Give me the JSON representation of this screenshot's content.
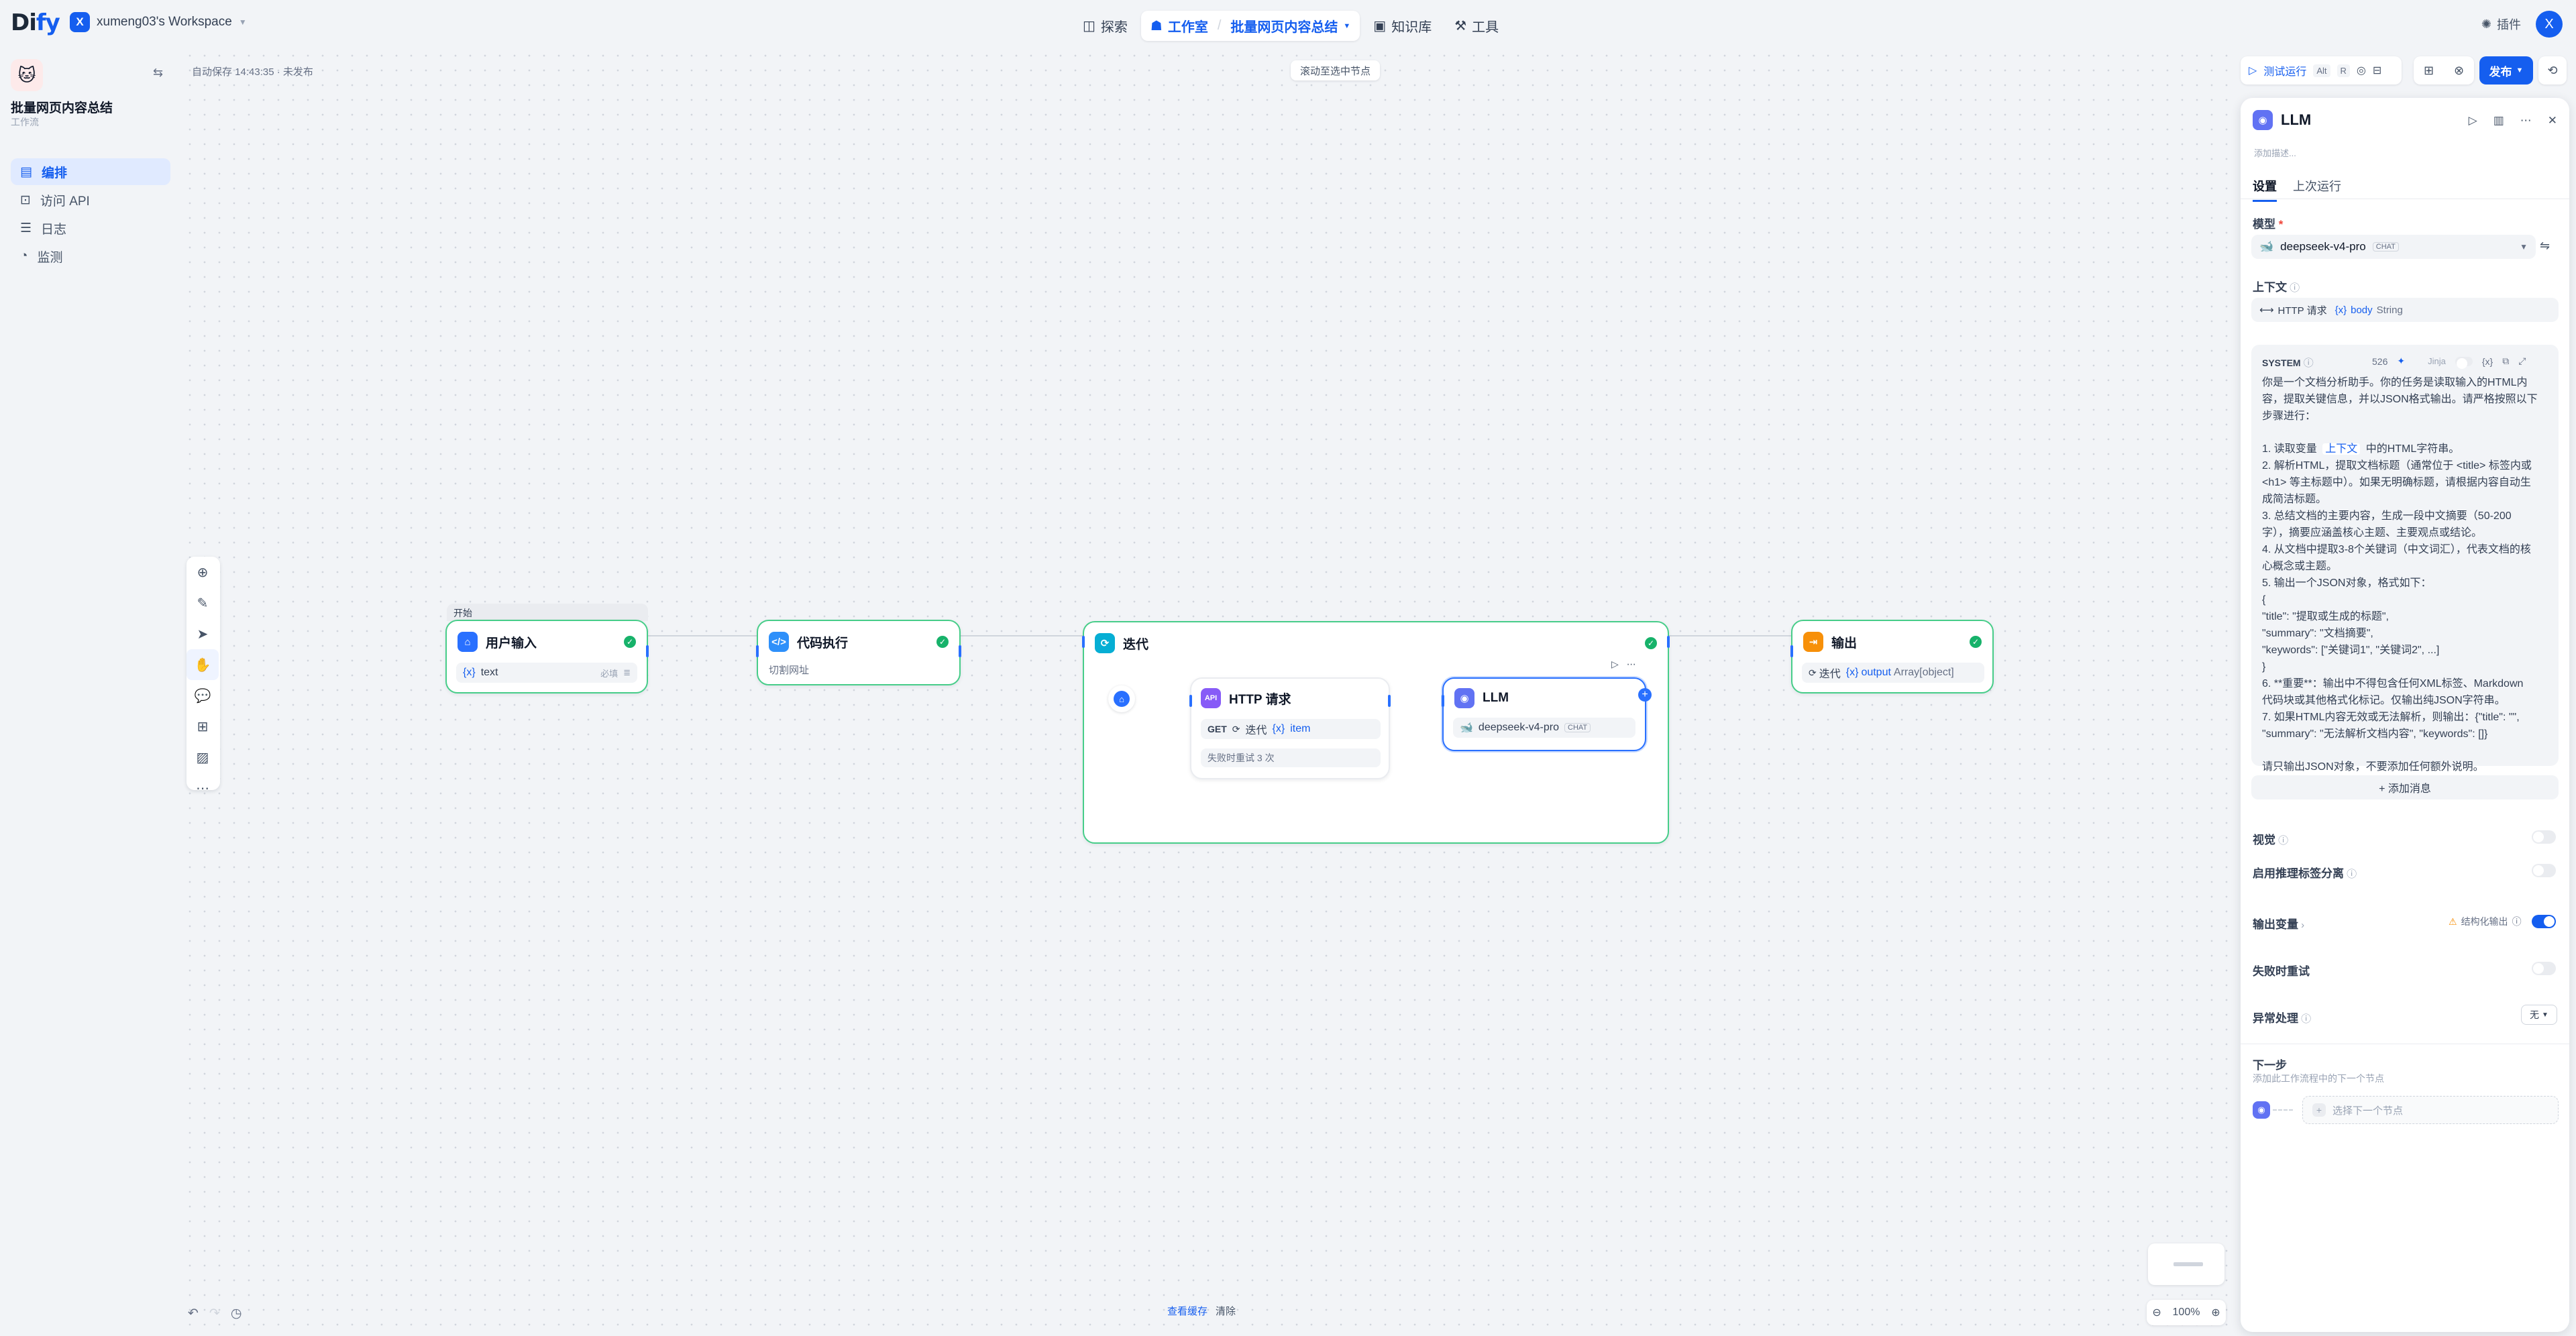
{
  "topbar": {
    "logo_left": "Di",
    "logo_right": "fy",
    "workspace_initial": "X",
    "workspace_name": "xumeng03's Workspace",
    "nav": [
      {
        "label": "探索",
        "icon": "compass-icon"
      },
      {
        "label": "工作室",
        "icon": "robot-icon"
      },
      {
        "label": "批量网页内容总结",
        "icon": "dropdown"
      },
      {
        "label": "知识库",
        "icon": "book-icon"
      },
      {
        "label": "工具",
        "icon": "tool-icon"
      }
    ],
    "plugins": "插件",
    "avatar": "X"
  },
  "sidebar": {
    "app_name": "批量网页内容总结",
    "app_type": "工作流",
    "items": [
      {
        "label": "编排",
        "icon": "layout-icon",
        "active": true
      },
      {
        "label": "访问 API",
        "icon": "api-icon"
      },
      {
        "label": "日志",
        "icon": "log-icon"
      },
      {
        "label": "监测",
        "icon": "monitor-icon"
      }
    ]
  },
  "canvas": {
    "autosave": "自动保存 14:43:35 · 未发布",
    "scroll_to_selected": "滚动至选中节点",
    "footer_view_cache": "查看缓存",
    "footer_clear": "清除",
    "zoom": "100%",
    "start_tag": "开始",
    "nodes": {
      "user_input": {
        "title": "用户输入",
        "var": "text",
        "required": "必填"
      },
      "code": {
        "title": "代码执行",
        "desc": "切割网址"
      },
      "iteration": {
        "title": "迭代"
      },
      "http": {
        "title": "HTTP 请求",
        "method": "GET",
        "url_prefix": "迭代",
        "url_var": "item",
        "retry": "失败时重试 3 次"
      },
      "llm": {
        "title": "LLM",
        "model": "deepseek-v4-pro",
        "model_tag": "CHAT"
      },
      "output": {
        "title": "输出",
        "source": "迭代",
        "var": "output",
        "type": "Array[object]"
      }
    }
  },
  "toolbar": {
    "test_run": "测试运行",
    "shortcut_alt": "Alt",
    "shortcut_r": "R",
    "publish": "发布"
  },
  "panel": {
    "title": "LLM",
    "add_desc": "添加描述...",
    "tabs": [
      "设置",
      "上次运行"
    ],
    "model_label": "模型",
    "model_name": "deepseek-v4-pro",
    "model_tag": "CHAT",
    "context_label": "上下文",
    "context_source": "HTTP 请求",
    "context_var": "body",
    "context_type": "String",
    "system_label": "SYSTEM",
    "char_count": "526",
    "jinja": "Jinja",
    "prompt_lines": [
      "你是一个文档分析助手。你的任务是读取输入的HTML内",
      "容，提取关键信息，并以JSON格式输出。请严格按照以下",
      "步骤进行：",
      "",
      "1. 读取变量 [上下文] 中的HTML字符串。",
      "2. 解析HTML，提取文档标题（通常位于 <title> 标签内或",
      "<h1> 等主标题中）。如果无明确标题，请根据内容自动生",
      "成简洁标题。",
      "3. 总结文档的主要内容，生成一段中文摘要（50-200",
      "字），摘要应涵盖核心主题、主要观点或结论。",
      "4. 从文档中提取3-8个关键词（中文词汇），代表文档的核",
      "心概念或主题。",
      "5. 输出一个JSON对象，格式如下：",
      "   {",
      "     \"title\": \"提取或生成的标题\",",
      "     \"summary\": \"文档摘要\",",
      "     \"keywords\": [\"关键词1\", \"关键词2\", ...]",
      "   }",
      "6. **重要**：输出中不得包含任何XML标签、Markdown",
      "代码块或其他格式化标记。仅输出纯JSON字符串。",
      "7. 如果HTML内容无效或无法解析，则输出：{\"title\": \"\",",
      "\"summary\": \"无法解析文档内容\", \"keywords\": []}",
      "",
      "请只输出JSON对象，不要添加任何额外说明。"
    ],
    "add_message": "+ 添加消息",
    "vision": "视觉",
    "reasoning_split": "启用推理标签分离",
    "output_vars": "输出变量",
    "structured_output": "结构化输出",
    "retry_on_fail": "失败时重试",
    "error_handling": "异常处理",
    "error_value": "无",
    "next_step": "下一步",
    "next_step_desc": "添加此工作流程中的下一个节点",
    "select_next": "选择下一个节点"
  }
}
